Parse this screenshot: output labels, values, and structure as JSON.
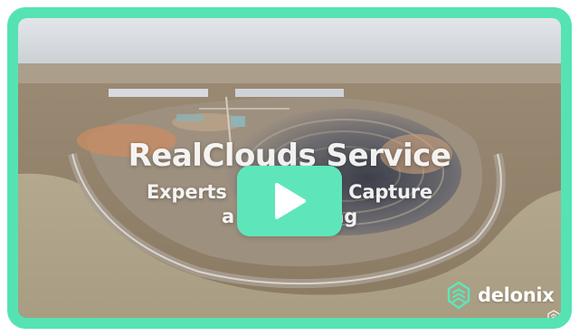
{
  "video": {
    "title": "RealClouds Service",
    "subtitle_line1": "Experts          eali   Capture",
    "subtitle_line2": "a              ing",
    "play_icon": "play-icon",
    "brand": "delonix",
    "brand_icon": "delonix-logo-icon",
    "corner_icon": "watermark-icon"
  },
  "colors": {
    "frame": "#55e3b3",
    "play_button": "#5ee6ba",
    "brand_mark": "#5ee6ba",
    "text": "#ffffff"
  }
}
